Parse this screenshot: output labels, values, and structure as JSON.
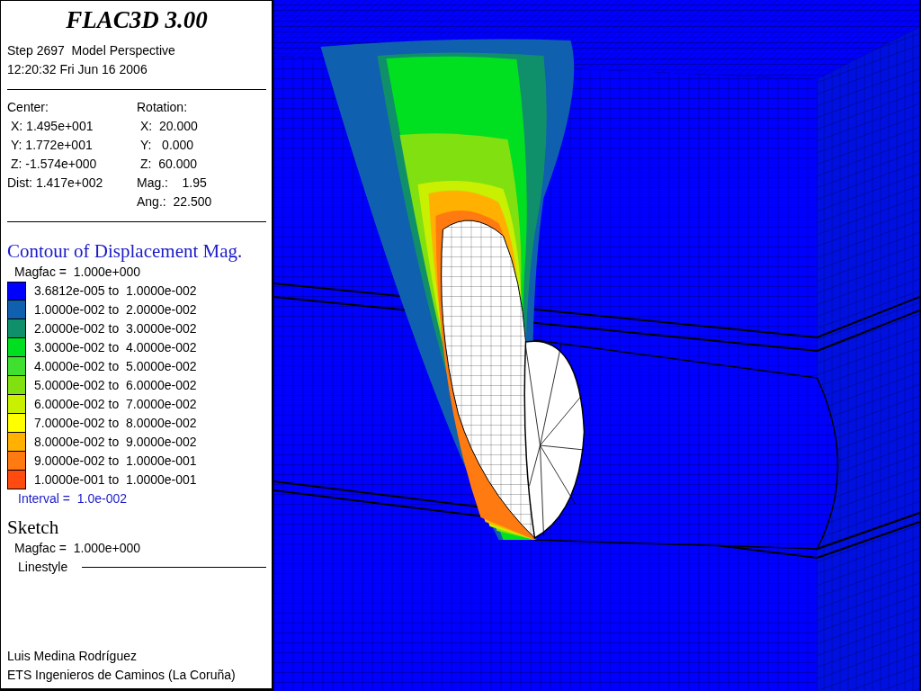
{
  "title": "FLAC3D 3.00",
  "header": [
    "Step 2697  Model Perspective",
    "12:20:32 Fri Jun 16 2006"
  ],
  "center": {
    "label": "Center:",
    "lines": [
      "X: 1.495e+001",
      "Y: 1.772e+001",
      "Z: -1.574e+000",
      "Dist: 1.417e+002"
    ]
  },
  "rotation": {
    "label": "Rotation:",
    "lines": [
      "X:  20.000",
      "Y:   0.000",
      "Z:  60.000",
      "Mag.:    1.95",
      "Ang.:  22.500"
    ]
  },
  "contour": {
    "title": "Contour of Displacement Mag.",
    "magfac": "Magfac =  1.000e+000",
    "bands": [
      {
        "color": "#0000ff",
        "label": "3.6812e-005 to  1.0000e-002"
      },
      {
        "color": "#1060b0",
        "label": "1.0000e-002 to  2.0000e-002"
      },
      {
        "color": "#10906a",
        "label": "2.0000e-002 to  3.0000e-002"
      },
      {
        "color": "#00e020",
        "label": "3.0000e-002 to  4.0000e-002"
      },
      {
        "color": "#40e030",
        "label": "4.0000e-002 to  5.0000e-002"
      },
      {
        "color": "#80e010",
        "label": "5.0000e-002 to  6.0000e-002"
      },
      {
        "color": "#c8f000",
        "label": "6.0000e-002 to  7.0000e-002"
      },
      {
        "color": "#ffff00",
        "label": "7.0000e-002 to  8.0000e-002"
      },
      {
        "color": "#ffb000",
        "label": "8.0000e-002 to  9.0000e-002"
      },
      {
        "color": "#ff7a10",
        "label": "9.0000e-002 to  1.0000e-001"
      },
      {
        "color": "#ff4a10",
        "label": "1.0000e-001 to  1.0000e-001"
      }
    ],
    "interval": "Interval =  1.0e-002"
  },
  "sketch": {
    "title": "Sketch",
    "magfac": "Magfac =  1.000e+000",
    "linestyle": "Linestyle"
  },
  "credits": [
    "Luis Medina Rodríguez",
    "ETS Ingenieros de Caminos (La Coruña)"
  ]
}
